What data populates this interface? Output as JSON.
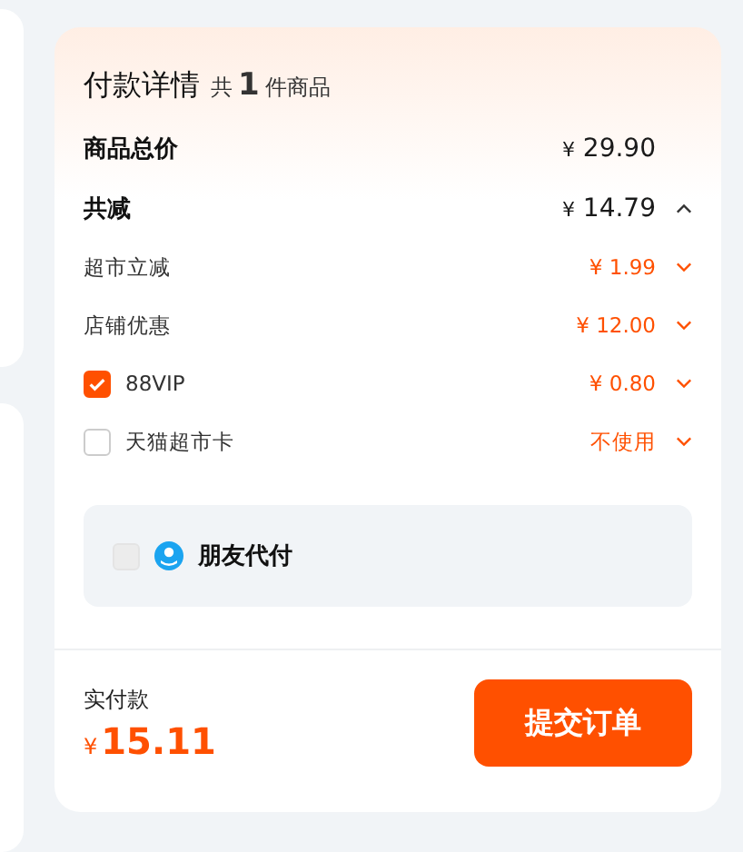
{
  "header": {
    "title": "付款详情",
    "count_prefix": "共",
    "count": "1",
    "count_suffix": "件商品"
  },
  "totals": [
    {
      "label": "商品总价",
      "currency": "¥",
      "amount": "29.90",
      "kind": "plain"
    },
    {
      "label": "共减",
      "currency": "¥",
      "amount": "14.79",
      "kind": "expandable",
      "expanded": true
    }
  ],
  "discounts": [
    {
      "kind": "plain",
      "label": "超市立减",
      "value": "¥ 1.99"
    },
    {
      "kind": "plain",
      "label": "店铺优惠",
      "value": "¥ 12.00"
    },
    {
      "kind": "checkbox",
      "label": "88VIP",
      "value": "¥ 0.80",
      "checked": true
    },
    {
      "kind": "checkbox",
      "label": "天猫超市卡",
      "value": "不使用",
      "checked": false
    }
  ],
  "friend_pay": {
    "label": "朋友代付",
    "checked": false,
    "disabled": true
  },
  "footer": {
    "label": "实付款",
    "currency": "¥",
    "amount": "15.11",
    "button": "提交订单"
  }
}
